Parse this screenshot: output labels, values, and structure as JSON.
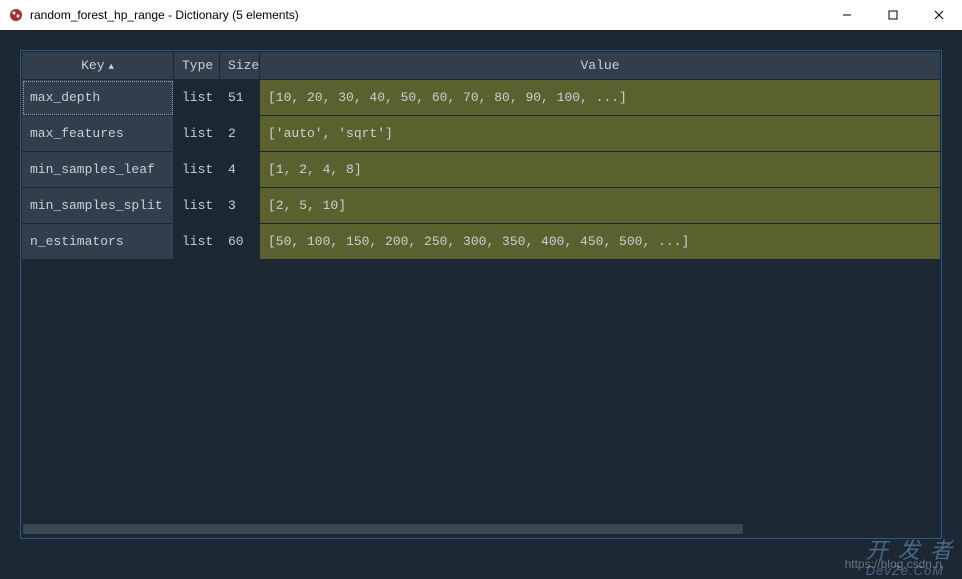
{
  "window": {
    "title": "random_forest_hp_range - Dictionary (5 elements)"
  },
  "table": {
    "headers": {
      "key": "Key",
      "type": "Type",
      "size": "Size",
      "value": "Value"
    },
    "rows": [
      {
        "key": "max_depth",
        "type": "list",
        "size": "51",
        "value": "[10, 20, 30, 40, 50, 60, 70, 80, 90, 100, ...]",
        "selected": true
      },
      {
        "key": "max_features",
        "type": "list",
        "size": "2",
        "value": "['auto', 'sqrt']",
        "selected": false
      },
      {
        "key": "min_samples_leaf",
        "type": "list",
        "size": "4",
        "value": "[1, 2, 4, 8]",
        "selected": false
      },
      {
        "key": "min_samples_split",
        "type": "list",
        "size": "3",
        "value": "[2, 5, 10]",
        "selected": false
      },
      {
        "key": "n_estimators",
        "type": "list",
        "size": "60",
        "value": "[50, 100, 150, 200, 250, 300, 350, 400, 450, 500, ...]",
        "selected": false
      }
    ]
  },
  "status": {
    "url": "https://blog.csdn.n"
  },
  "watermark": {
    "main": "开 发 者",
    "sub": "DevZe.CoM"
  }
}
